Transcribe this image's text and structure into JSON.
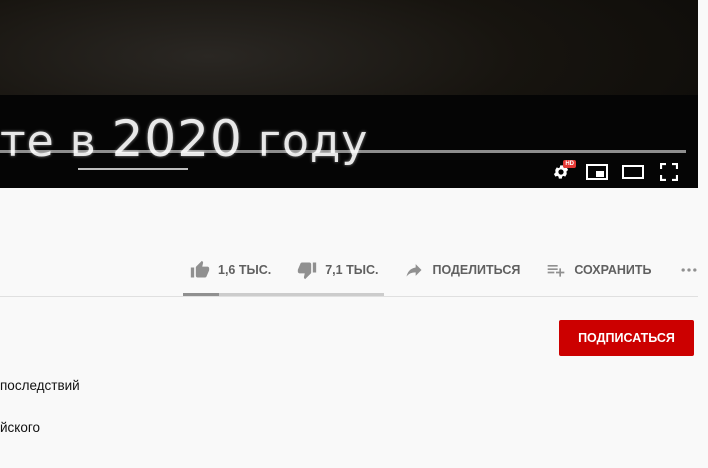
{
  "video": {
    "caption_pre": "те в ",
    "caption_year": "2020",
    "caption_post": " году",
    "hd_badge": "HD",
    "icons": [
      "settings-icon",
      "miniplayer-icon",
      "theater-icon",
      "fullscreen-icon"
    ]
  },
  "actions": {
    "like_count": "1,6 ТЫС.",
    "dislike_count": "7,1 ТЫС.",
    "share_label": "ПОДЕЛИТЬСЯ",
    "save_label": "СОХРАНИТЬ",
    "like_ratio": 0.18
  },
  "subscribe_label": "ПОДПИСАТЬСЯ",
  "description": {
    "line1": "последствий",
    "line2": "йского"
  },
  "colors": {
    "subscribe": "#cc0000",
    "icon_gray": "#909090",
    "text_gray": "#606060"
  }
}
